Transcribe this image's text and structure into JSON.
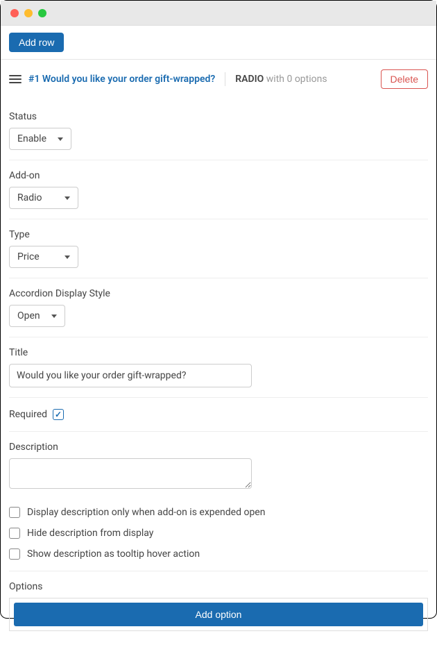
{
  "titlebar": {
    "dots": [
      {
        "color": "#ff5f57"
      },
      {
        "color": "#febc2e"
      },
      {
        "color": "#28c840"
      }
    ]
  },
  "toolbar": {
    "add_row_label": "Add row"
  },
  "header": {
    "row_title": "#1 Would you like your order gift-wrapped?",
    "type_label": "RADIO",
    "type_suffix": " with 0 options",
    "delete_label": "Delete"
  },
  "fields": {
    "status": {
      "label": "Status",
      "value": "Enable"
    },
    "addon": {
      "label": "Add-on",
      "value": "Radio"
    },
    "type": {
      "label": "Type",
      "value": "Price"
    },
    "accordion": {
      "label": "Accordion Display Style",
      "value": "Open"
    },
    "title": {
      "label": "Title",
      "value": "Would you like your order gift-wrapped?"
    },
    "required": {
      "label": "Required",
      "checked": true
    },
    "description": {
      "label": "Description",
      "value": ""
    },
    "desc_opts": [
      {
        "label": "Display description only when add-on is expended open",
        "checked": false
      },
      {
        "label": "Hide description from display",
        "checked": false
      },
      {
        "label": "Show description as tooltip hover action",
        "checked": false
      }
    ],
    "options": {
      "label": "Options",
      "add_label": "Add option"
    }
  }
}
